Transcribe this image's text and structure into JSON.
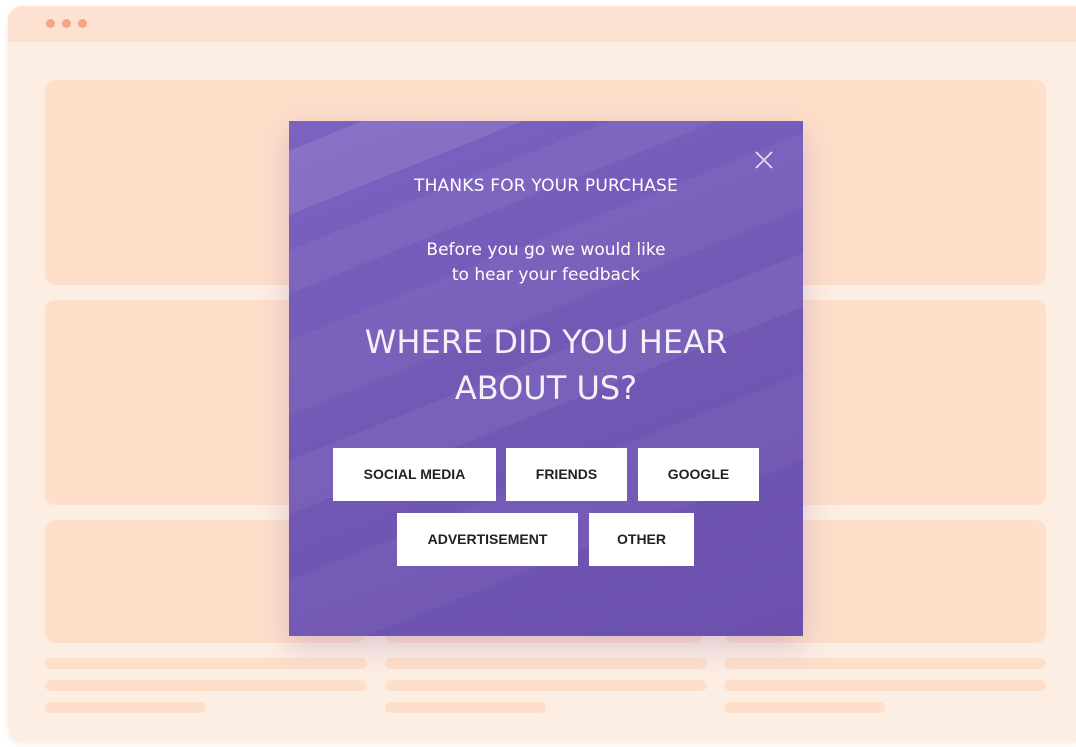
{
  "popup": {
    "heading": "THANKS FOR YOUR PURCHASE",
    "subtitle_line1": "Before you go we would like",
    "subtitle_line2": "to hear your feedback",
    "question_line1": "WHERE DID YOU HEAR",
    "question_line2": "ABOUT US?",
    "close_icon": "close-icon",
    "options": [
      {
        "label": "SOCIAL MEDIA"
      },
      {
        "label": "FRIENDS"
      },
      {
        "label": "GOOGLE"
      },
      {
        "label": "ADVERTISEMENT"
      },
      {
        "label": "OTHER"
      }
    ]
  },
  "colors": {
    "popup_background": "#7359b6",
    "page_background": "#fdeee3",
    "placeholder_block": "#fedfca",
    "window_dots": "#f5a784"
  }
}
